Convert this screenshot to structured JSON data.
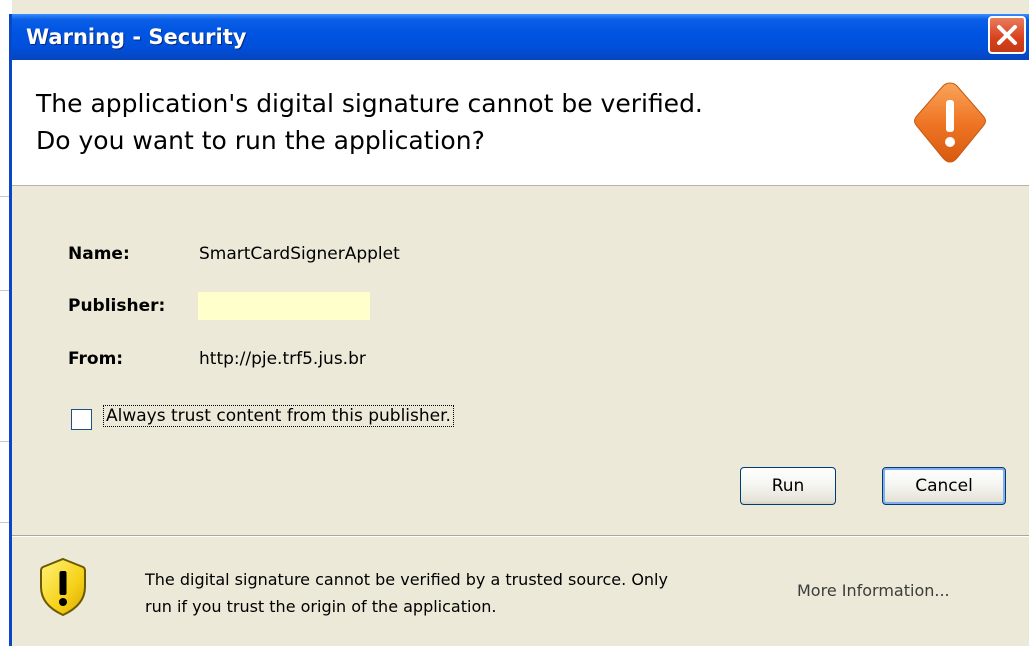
{
  "window": {
    "title": "Warning - Security",
    "close_icon": "close-icon"
  },
  "header": {
    "line1": "The application's digital signature cannot be verified.",
    "line2": "Do you want to run the application?",
    "icon": "warning-diamond-icon"
  },
  "fields": {
    "name_label": "Name:",
    "name_value": "SmartCardSignerApplet",
    "publisher_label": "Publisher:",
    "publisher_value": "",
    "from_label": "From:",
    "from_value": "http://pje.trf5.jus.br"
  },
  "trust_checkbox": {
    "label": "Always trust content from this publisher.",
    "checked": false
  },
  "buttons": {
    "run": "Run",
    "cancel": "Cancel"
  },
  "footer": {
    "icon": "shield-warning-icon",
    "line1": "The digital signature cannot be verified by a trusted source.  Only",
    "line2": "run if you trust the origin of the application.",
    "more_info": "More Information..."
  },
  "colors": {
    "titlebar": "#0054e3",
    "dialog_bg": "#ece9d8",
    "header_bg": "#ffffff",
    "publisher_highlight": "#ffffcc",
    "warning_orange": "#f07a2c",
    "close_red": "#d8401c"
  }
}
